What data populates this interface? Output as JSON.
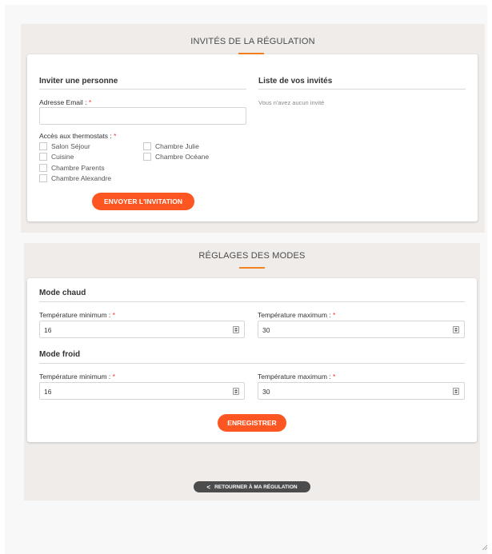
{
  "invites_section": {
    "title": "INVITÉS DE LA RÉGULATION",
    "invite_heading": "Inviter une personne",
    "list_heading": "Liste de vos invités",
    "email_label": "Adresse Email :",
    "required_mark": "*",
    "email_value": "",
    "thermostats_label": "Accès aux thermostats :",
    "thermostats_col1": [
      "Salon Séjour",
      "Cuisine",
      "Chambre Parents",
      "Chambre Alexandre"
    ],
    "thermostats_col2": [
      "Chambre Julie",
      "Chambre Océane"
    ],
    "send_button": "ENVOYER L'INVITATION",
    "no_guests_text": "Vous n'avez aucun invité"
  },
  "modes_section": {
    "title": "RÉGLAGES DES MODES",
    "hot_heading": "Mode chaud",
    "cold_heading": "Mode froid",
    "min_label": "Température minimum :",
    "max_label": "Température maximum :",
    "required_mark": "*",
    "hot_min": "16",
    "hot_max": "30",
    "cold_min": "16",
    "cold_max": "30",
    "save_button": "ENREGISTRER"
  },
  "back_button": "RETOURNER À MA RÉGULATION",
  "colors": {
    "accent_orange": "#fe5622",
    "title_underline": "#f58220",
    "section_bg": "#efecea",
    "back_button_bg": "#4c4c4c"
  }
}
